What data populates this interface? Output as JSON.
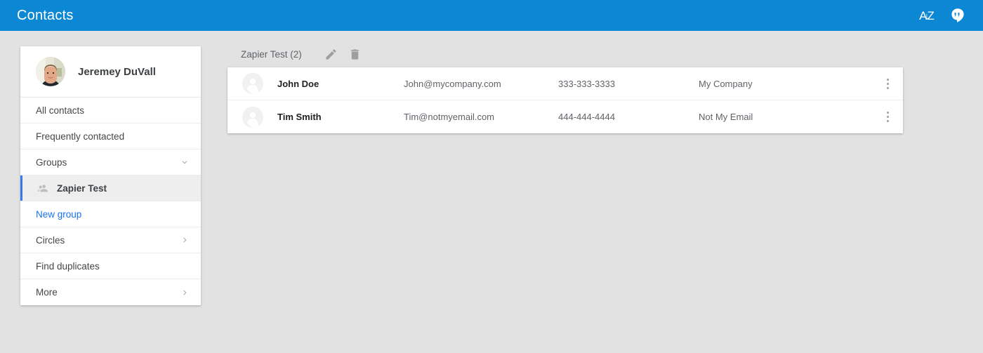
{
  "colors": {
    "appbar_blue": "#0c87d3",
    "page_bg": "#e2e2e2",
    "card_white": "#ffffff",
    "accent_blue": "#1a73e8",
    "selected_bar": "#3b78e7",
    "selected_bg": "#eeeeee"
  },
  "appbar": {
    "title": "Contacts",
    "actions": [
      {
        "name": "sort-az-icon",
        "letter_a": "A",
        "letter_z": "Z",
        "arrow": "↓"
      },
      {
        "name": "hangouts-icon",
        "glyph": "”"
      }
    ]
  },
  "sidebar": {
    "profile": {
      "name": "Jeremey DuVall",
      "avatar": "user-photo"
    },
    "items": [
      {
        "label": "All contacts",
        "icon": "",
        "trailing": "",
        "style": "plain",
        "name": "sidebar-item-all-contacts"
      },
      {
        "label": "Frequently contacted",
        "icon": "",
        "trailing": "",
        "style": "plain",
        "name": "sidebar-item-frequently-contacted"
      },
      {
        "label": "Groups",
        "icon": "",
        "trailing": "⌄",
        "style": "plain",
        "name": "sidebar-item-groups"
      },
      {
        "label": "Zapier Test",
        "icon": "group-icon",
        "trailing": "",
        "style": "selected",
        "name": "sidebar-item-zapier-test"
      },
      {
        "label": "New group",
        "icon": "",
        "trailing": "",
        "style": "link",
        "name": "sidebar-item-new-group"
      },
      {
        "label": "Circles",
        "icon": "",
        "trailing": "›",
        "style": "plain",
        "name": "sidebar-item-circles"
      },
      {
        "label": "Find duplicates",
        "icon": "",
        "trailing": "",
        "style": "plain",
        "name": "sidebar-item-find-duplicates"
      },
      {
        "label": "More",
        "icon": "",
        "trailing": "›",
        "style": "plain",
        "name": "sidebar-item-more"
      }
    ]
  },
  "main": {
    "header": {
      "group_title": "Zapier Test (2)",
      "edit_label": "edit-group",
      "delete_label": "delete-group"
    },
    "contacts": [
      {
        "name": "John Doe",
        "email": "John@mycompany.com",
        "phone": "333-333-3333",
        "company": "My Company"
      },
      {
        "name": "Tim Smith",
        "email": "Tim@notmyemail.com",
        "phone": "444-444-4444",
        "company": "Not My Email"
      }
    ]
  }
}
